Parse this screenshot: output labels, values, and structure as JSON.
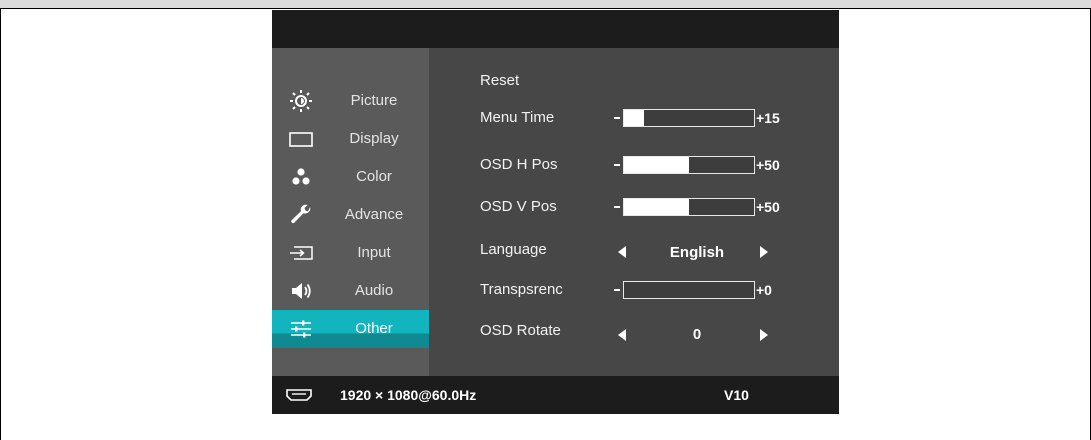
{
  "sidebar": {
    "items": [
      {
        "label": "Picture",
        "icon": "brightness-icon"
      },
      {
        "label": "Display",
        "icon": "display-icon"
      },
      {
        "label": "Color",
        "icon": "color-icon"
      },
      {
        "label": "Advance",
        "icon": "wrench-icon"
      },
      {
        "label": "Input",
        "icon": "input-icon"
      },
      {
        "label": "Audio",
        "icon": "speaker-icon"
      },
      {
        "label": "Other",
        "icon": "sliders-icon",
        "active": true
      }
    ]
  },
  "content": {
    "reset_label": "Reset",
    "menu_time": {
      "label": "Menu Time",
      "value": "+15",
      "level": 0.15
    },
    "osd_h_pos": {
      "label": "OSD H Pos",
      "value": "+50",
      "level": 0.5
    },
    "osd_v_pos": {
      "label": "OSD V Pos",
      "value": "+50",
      "level": 0.5
    },
    "language": {
      "label": "Language",
      "value": "English"
    },
    "transparency": {
      "label": "Transpsrenc",
      "value": "+0",
      "level": 0.0
    },
    "osd_rotate": {
      "label": "OSD Rotate",
      "value": "0"
    }
  },
  "footer": {
    "resolution": "1920 × 1080@60.0Hz",
    "version": "V10",
    "icon": "hdmi-icon"
  },
  "colors": {
    "accent": "#12b4be",
    "sidebar_bg": "#5a5a5a",
    "content_bg": "#474747",
    "header_bg": "#1c1c1c"
  }
}
